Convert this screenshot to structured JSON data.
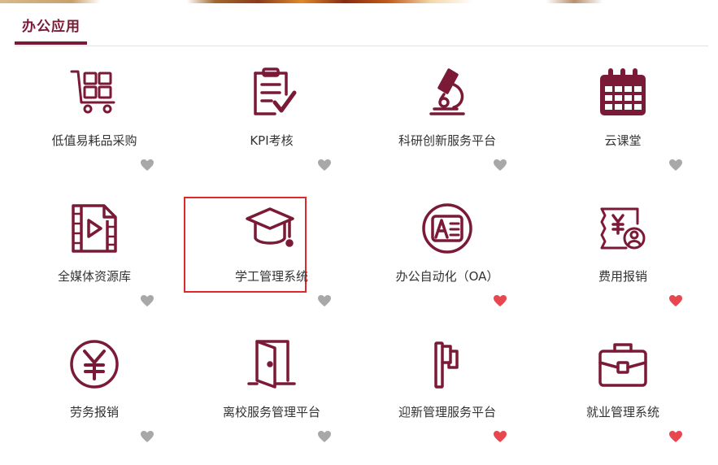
{
  "section": {
    "title": "办公应用"
  },
  "colors": {
    "brand": "#7a1a36",
    "heart_active": "#e8474f",
    "heart_inactive": "#a8a8a8",
    "selection": "#e0272b"
  },
  "apps": [
    {
      "label": "低值易耗品采购",
      "icon": "shopping-cart-grid-icon",
      "favorited": false
    },
    {
      "label": "KPI考核",
      "icon": "clipboard-check-icon",
      "favorited": false
    },
    {
      "label": "科研创新服务平台",
      "icon": "microscope-icon",
      "favorited": false
    },
    {
      "label": "云课堂",
      "icon": "calendar-icon",
      "favorited": false
    },
    {
      "label": "全媒体资源库",
      "icon": "video-file-icon",
      "favorited": false
    },
    {
      "label": "学工管理系统",
      "icon": "graduation-cap-icon",
      "favorited": false,
      "selected": true
    },
    {
      "label": "办公自动化（OA）",
      "icon": "document-a-icon",
      "favorited": true
    },
    {
      "label": "费用报销",
      "icon": "yen-receipt-icon",
      "favorited": true
    },
    {
      "label": "劳务报销",
      "icon": "yen-circle-icon",
      "favorited": false
    },
    {
      "label": "离校服务管理平台",
      "icon": "door-exit-icon",
      "favorited": false
    },
    {
      "label": "迎新管理服务平台",
      "icon": "flag-icon",
      "favorited": true
    },
    {
      "label": "就业管理系统",
      "icon": "briefcase-icon",
      "favorited": true
    }
  ]
}
